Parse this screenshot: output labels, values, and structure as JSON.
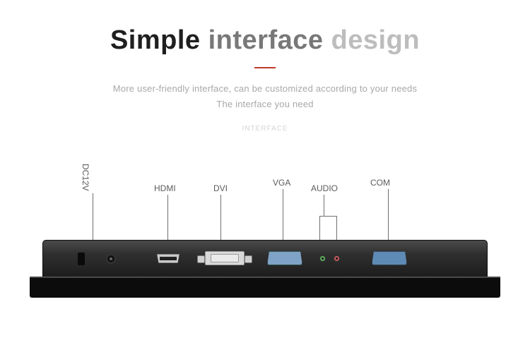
{
  "heading": {
    "word1": "Simple",
    "word2": "interface",
    "word3": "design"
  },
  "sub": {
    "line1": "More user-friendly interface, can be customized according to your needs",
    "line2": "The interface you need"
  },
  "section_label": "INTERFACE",
  "ports": {
    "dc12v": "DC12V",
    "hdmi": "HDMI",
    "dvi": "DVI",
    "vga": "VGA",
    "audio": "AUDIO",
    "com": "COM"
  }
}
